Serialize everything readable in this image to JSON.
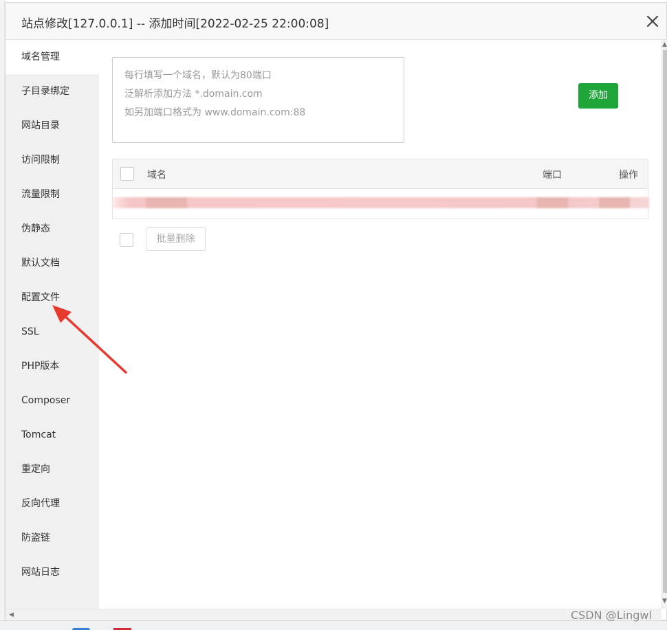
{
  "dialog": {
    "title": "站点修改[127.0.0.1] -- 添加时间[2022-02-25 22:00:08]"
  },
  "sidebar": {
    "items": [
      {
        "label": "域名管理",
        "active": true
      },
      {
        "label": "子目录绑定"
      },
      {
        "label": "网站目录"
      },
      {
        "label": "访问限制"
      },
      {
        "label": "流量限制"
      },
      {
        "label": "伪静态"
      },
      {
        "label": "默认文档"
      },
      {
        "label": "配置文件"
      },
      {
        "label": "SSL"
      },
      {
        "label": "PHP版本"
      },
      {
        "label": "Composer"
      },
      {
        "label": "Tomcat"
      },
      {
        "label": "重定向"
      },
      {
        "label": "反向代理"
      },
      {
        "label": "防盗链"
      },
      {
        "label": "网站日志"
      }
    ]
  },
  "domain_form": {
    "placeholder_lines": [
      "每行填写一个域名，默认为80端口",
      "泛解析添加方法 *.domain.com",
      "如另加端口格式为 www.domain.com:88"
    ],
    "add_button": "添加"
  },
  "table": {
    "headers": [
      "域名",
      "端口",
      "操作"
    ]
  },
  "bulk": {
    "delete_button": "批量删除"
  },
  "watermark": "CSDN @Lingwl",
  "colors": {
    "accent_green": "#20a53a",
    "annotation_arrow": "#e8392f"
  }
}
